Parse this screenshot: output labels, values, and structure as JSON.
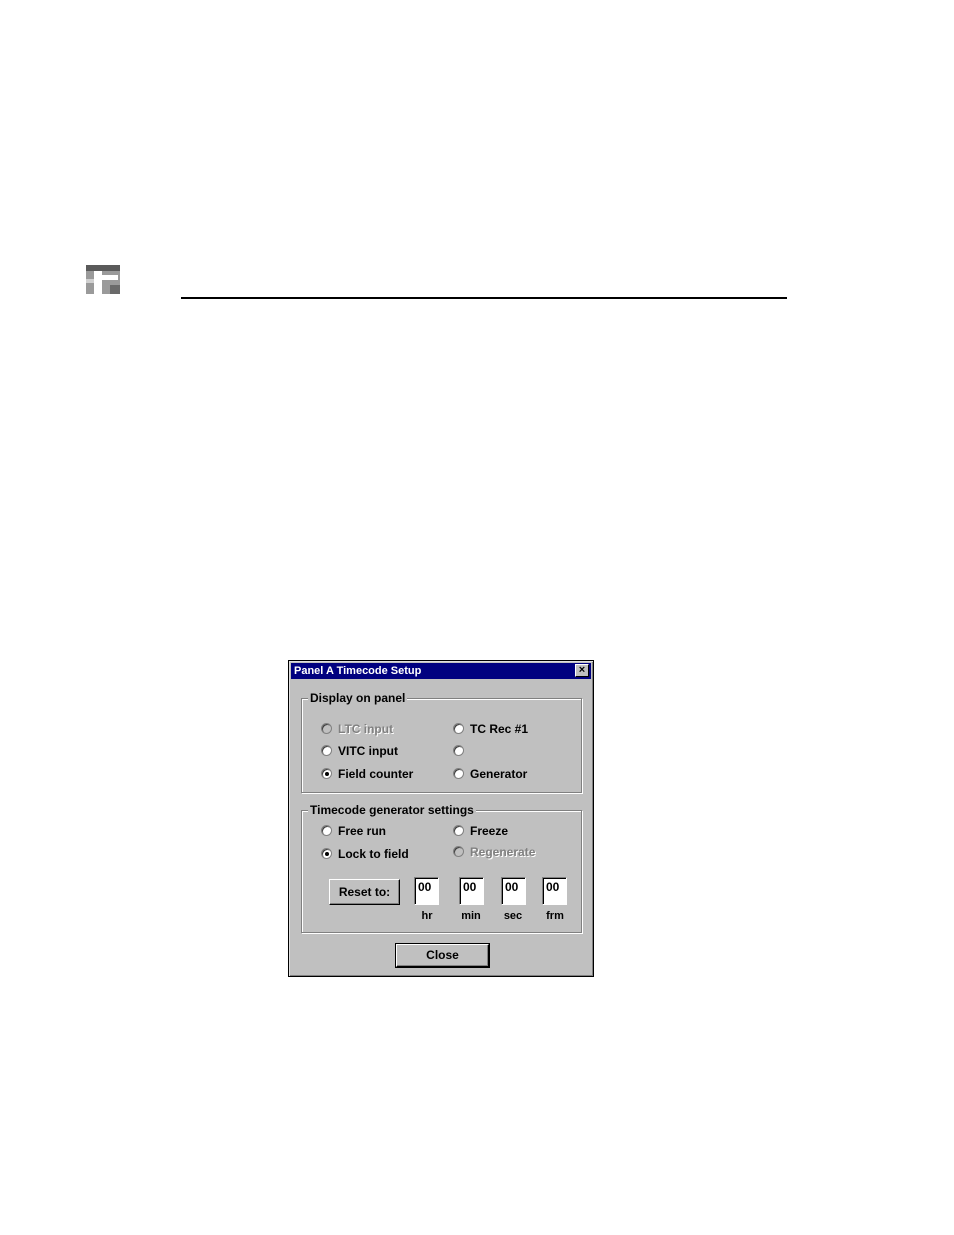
{
  "dialog": {
    "title": "Panel A Timecode Setup",
    "close_glyph": "×",
    "display_group": {
      "label": "Display on panel",
      "options": [
        {
          "label": "LTC input",
          "selected": false,
          "enabled": false
        },
        {
          "label": "TC Rec #1",
          "selected": false,
          "enabled": true
        },
        {
          "label": "VITC input",
          "selected": false,
          "enabled": true
        },
        {
          "label": "",
          "selected": false,
          "enabled": true
        },
        {
          "label": "Field counter",
          "selected": true,
          "enabled": true
        },
        {
          "label": "Generator",
          "selected": false,
          "enabled": true
        }
      ]
    },
    "generator_group": {
      "label": "Timecode generator settings",
      "options": [
        {
          "label": "Free run",
          "selected": false,
          "enabled": true
        },
        {
          "label": "Freeze",
          "selected": false,
          "enabled": true
        },
        {
          "label": "Lock to field",
          "selected": true,
          "enabled": true
        },
        {
          "label": "Regenerate",
          "selected": false,
          "enabled": false
        }
      ],
      "reset_button": "Reset to:",
      "fields": [
        {
          "value": "00",
          "unit": "hr"
        },
        {
          "value": "00",
          "unit": "min"
        },
        {
          "value": "00",
          "unit": "sec"
        },
        {
          "value": "00",
          "unit": "frm"
        }
      ]
    },
    "close_button": "Close"
  },
  "icons": {
    "page_logo": "logo-icon",
    "radio": "radio-button-icon",
    "close": "close-icon"
  },
  "colors": {
    "titlebar": "#000080",
    "dialog_face": "#c0c0c0",
    "disabled_text": "#808080"
  }
}
